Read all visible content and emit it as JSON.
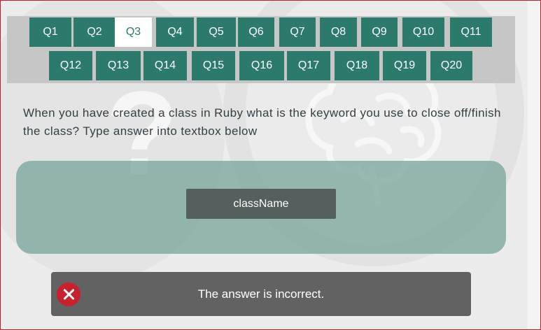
{
  "nav": {
    "row1": [
      {
        "label": "Q1",
        "active": false
      },
      {
        "label": "Q2",
        "active": false
      },
      {
        "label": "Q3",
        "active": true
      },
      {
        "label": "Q4",
        "active": false
      },
      {
        "label": "Q5",
        "active": false
      },
      {
        "label": "Q6",
        "active": false
      },
      {
        "label": "Q7",
        "active": false
      },
      {
        "label": "Q8",
        "active": false
      },
      {
        "label": "Q9",
        "active": false
      },
      {
        "label": "Q10",
        "active": false
      },
      {
        "label": "Q11",
        "active": false
      }
    ],
    "row2": [
      {
        "label": "Q12",
        "active": false
      },
      {
        "label": "Q13",
        "active": false
      },
      {
        "label": "Q14",
        "active": false
      },
      {
        "label": "Q15",
        "active": false
      },
      {
        "label": "Q16",
        "active": false
      },
      {
        "label": "Q17",
        "active": false
      },
      {
        "label": "Q18",
        "active": false
      },
      {
        "label": "Q19",
        "active": false
      },
      {
        "label": "Q20",
        "active": false
      }
    ]
  },
  "question": {
    "text": "When you have created a class in Ruby what is the keyword you use to close off/finish the class? Type answer into textbox below"
  },
  "answer": {
    "value": "className"
  },
  "feedback": {
    "text": "The answer is incorrect.",
    "status": "incorrect",
    "icon": "x-circle-icon"
  },
  "colors": {
    "accent": "#2b7a6c",
    "error": "#c8202c"
  }
}
